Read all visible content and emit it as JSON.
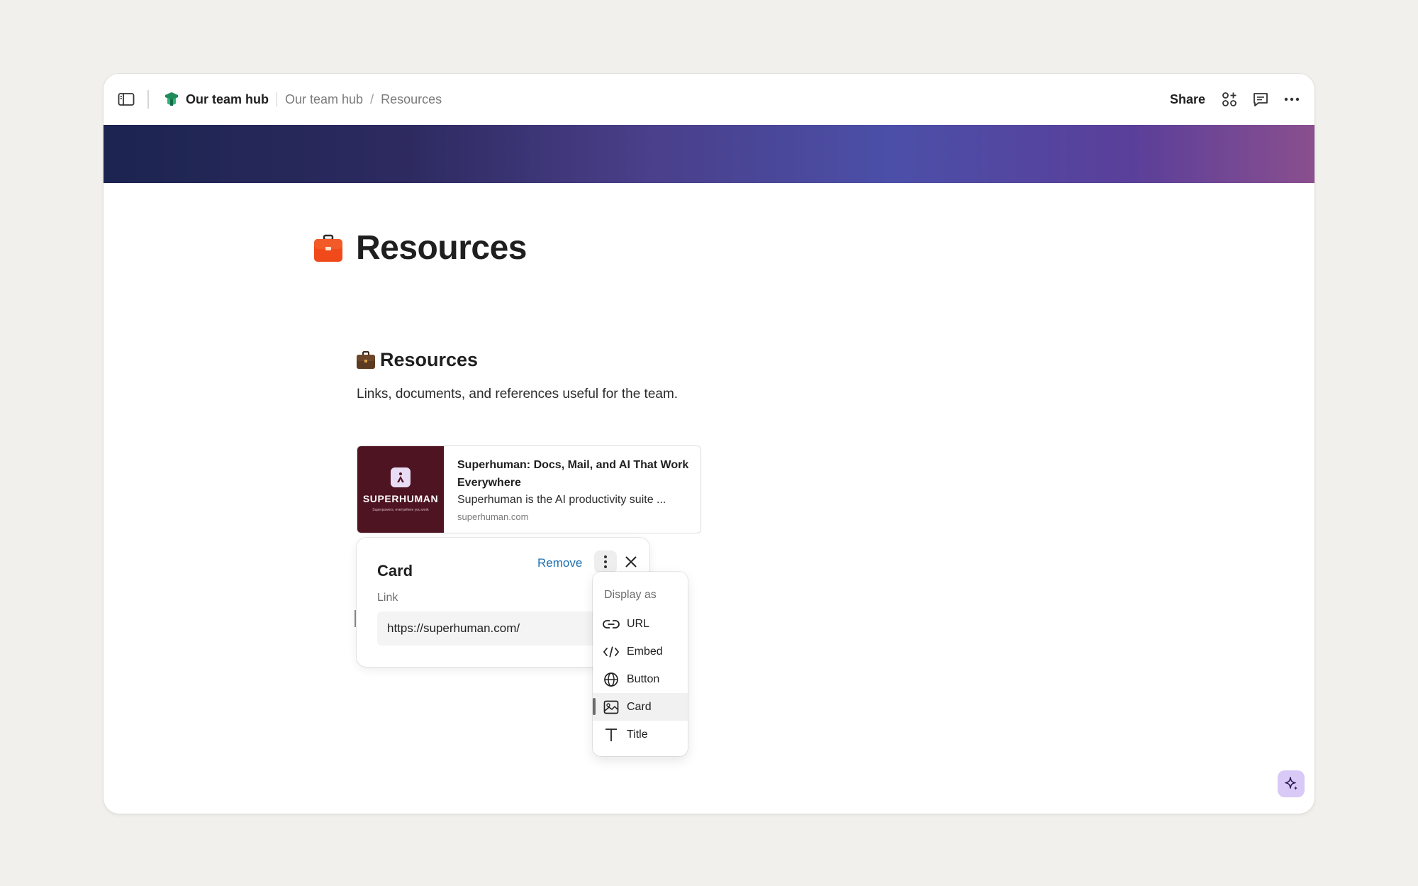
{
  "topbar": {
    "hub_name": "Our team hub",
    "breadcrumbs": [
      "Our team hub",
      "Resources"
    ],
    "breadcrumb_separator": "/",
    "share_label": "Share"
  },
  "page": {
    "title": "Resources",
    "section_heading": "Resources",
    "section_description": "Links, documents, and references useful for the team."
  },
  "link_card": {
    "thumb_brand": "SUPERHUMAN",
    "thumb_tagline": "Superpowers, everywhere you work",
    "title": "Superhuman: Docs, Mail, and AI That Work Everywhere",
    "description": "Superhuman is the AI productivity suite ...",
    "domain": "superhuman.com"
  },
  "edit_popover": {
    "title": "Card",
    "remove_label": "Remove",
    "link_label": "Link",
    "link_value": "https://superhuman.com/"
  },
  "display_menu": {
    "header": "Display as",
    "items": [
      {
        "label": "URL",
        "icon": "link-icon",
        "selected": false
      },
      {
        "label": "Embed",
        "icon": "code-icon",
        "selected": false
      },
      {
        "label": "Button",
        "icon": "globe-icon",
        "selected": false
      },
      {
        "label": "Card",
        "icon": "image-card-icon",
        "selected": true
      },
      {
        "label": "Title",
        "icon": "text-t-icon",
        "selected": false
      }
    ]
  },
  "colors": {
    "accent_link": "#1d6fb0",
    "ai_button": "#d8c9f7",
    "thumb_bg": "#4e1422",
    "briefcase": "#f04a1a"
  }
}
